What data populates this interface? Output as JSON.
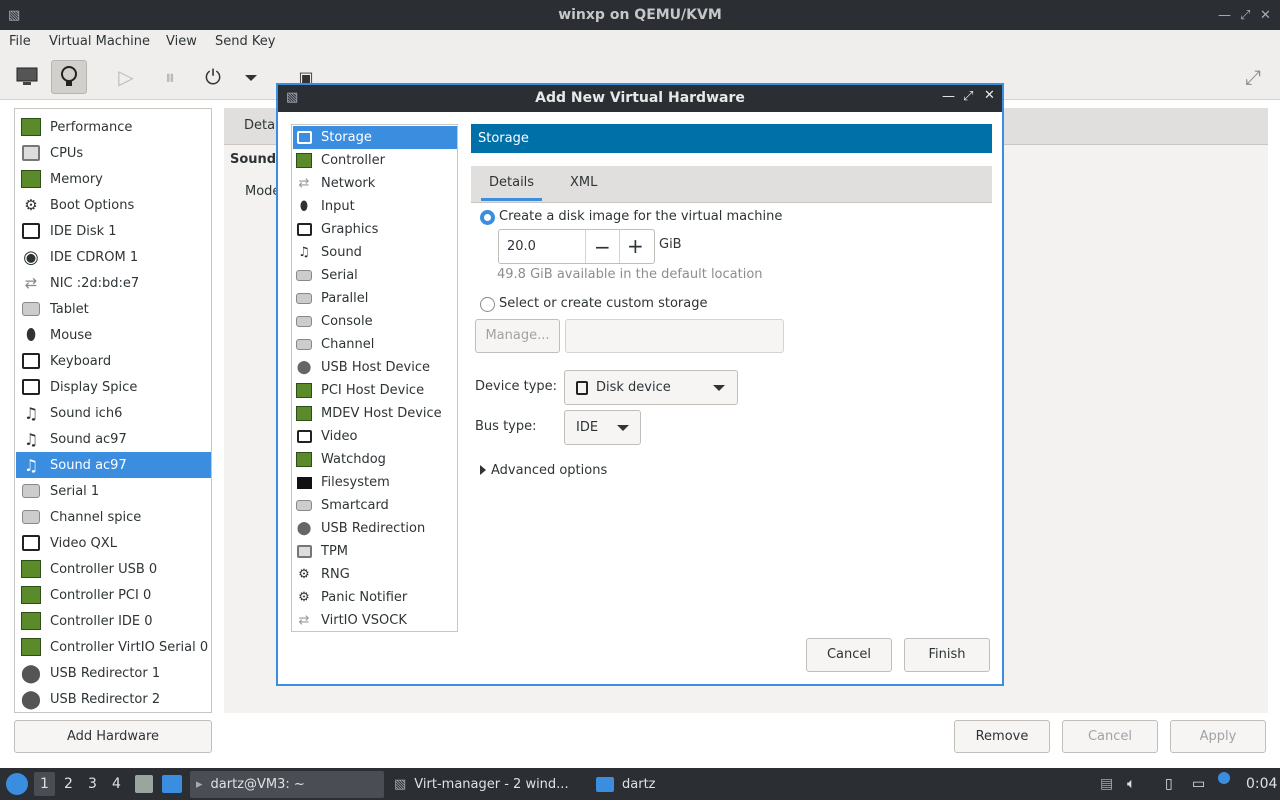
{
  "window": {
    "title": "winxp on QEMU/KVM"
  },
  "menu": [
    "File",
    "Virtual Machine",
    "View",
    "Send Key"
  ],
  "hardware_list": [
    {
      "label": "Performance",
      "icon": "performance-icon"
    },
    {
      "label": "CPUs",
      "icon": "cpu-icon"
    },
    {
      "label": "Memory",
      "icon": "memory-icon"
    },
    {
      "label": "Boot Options",
      "icon": "gear-icon"
    },
    {
      "label": "IDE Disk 1",
      "icon": "disk-icon"
    },
    {
      "label": "IDE CDROM 1",
      "icon": "cdrom-icon"
    },
    {
      "label": "NIC :2d:bd:e7",
      "icon": "network-icon"
    },
    {
      "label": "Tablet",
      "icon": "tablet-icon"
    },
    {
      "label": "Mouse",
      "icon": "mouse-icon"
    },
    {
      "label": "Keyboard",
      "icon": "keyboard-icon"
    },
    {
      "label": "Display Spice",
      "icon": "display-icon"
    },
    {
      "label": "Sound ich6",
      "icon": "sound-icon"
    },
    {
      "label": "Sound ac97",
      "icon": "sound-icon"
    },
    {
      "label": "Sound ac97",
      "icon": "sound-icon"
    },
    {
      "label": "Serial 1",
      "icon": "serial-icon"
    },
    {
      "label": "Channel spice",
      "icon": "channel-icon"
    },
    {
      "label": "Video QXL",
      "icon": "video-icon"
    },
    {
      "label": "Controller USB 0",
      "icon": "controller-icon"
    },
    {
      "label": "Controller PCI 0",
      "icon": "controller-icon"
    },
    {
      "label": "Controller IDE 0",
      "icon": "controller-icon"
    },
    {
      "label": "Controller VirtIO Serial 0",
      "icon": "controller-icon"
    },
    {
      "label": "USB Redirector 1",
      "icon": "usb-icon"
    },
    {
      "label": "USB Redirector 2",
      "icon": "usb-icon"
    }
  ],
  "add_hardware_label": "Add Hardware",
  "right_pane": {
    "tab": "Deta",
    "section": "Sound",
    "model_label": "Mode"
  },
  "bottom_buttons": {
    "remove": "Remove",
    "cancel": "Cancel",
    "apply": "Apply"
  },
  "dialog": {
    "title": "Add New Virtual Hardware",
    "device_types": [
      "Storage",
      "Controller",
      "Network",
      "Input",
      "Graphics",
      "Sound",
      "Serial",
      "Parallel",
      "Console",
      "Channel",
      "USB Host Device",
      "PCI Host Device",
      "MDEV Host Device",
      "Video",
      "Watchdog",
      "Filesystem",
      "Smartcard",
      "USB Redirection",
      "TPM",
      "RNG",
      "Panic Notifier",
      "VirtIO VSOCK"
    ],
    "section_title": "Storage",
    "tabs": [
      "Details",
      "XML"
    ],
    "create_disk_label": "Create a disk image for the virtual machine",
    "disk_size": "20.0",
    "disk_unit": "GiB",
    "available_text": "49.8 GiB available in the default location",
    "custom_storage_label": "Select or create custom storage",
    "manage_label": "Manage...",
    "custom_path": "",
    "device_type_label": "Device type:",
    "device_type_value": "Disk device",
    "bus_type_label": "Bus type:",
    "bus_type_value": "IDE",
    "advanced_label": "Advanced options",
    "cancel_label": "Cancel",
    "finish_label": "Finish"
  },
  "taskbar": {
    "workspaces": [
      "1",
      "2",
      "3",
      "4"
    ],
    "tasks": [
      "dartz@VM3: ~",
      "Virt-manager - 2 wind...",
      "dartz"
    ],
    "clock": "0:04"
  },
  "colors": {
    "accent": "#3b8de0",
    "header": "#0070a8",
    "titlebar": "#2b2e33"
  }
}
